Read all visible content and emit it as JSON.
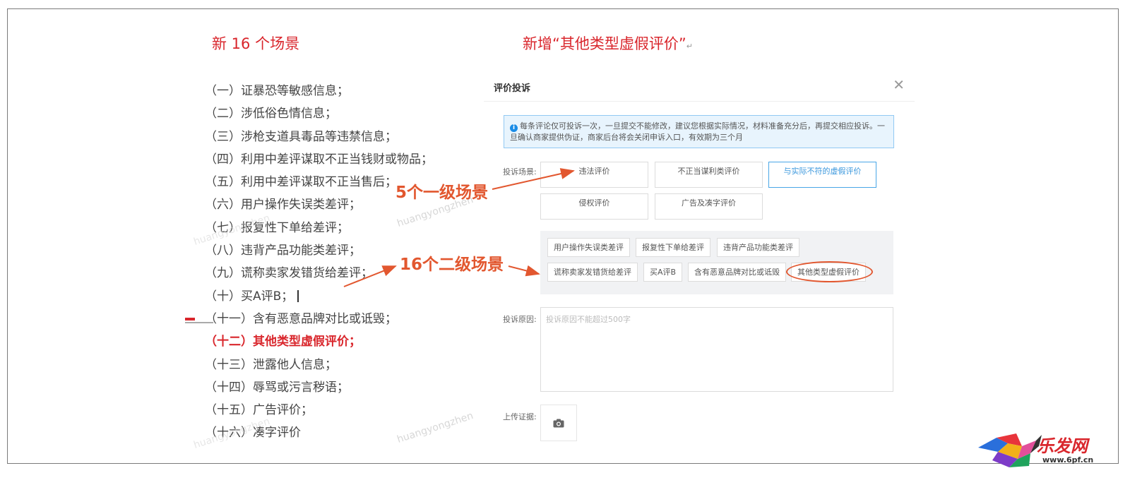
{
  "slide": {
    "left_title": "新 16 个场景",
    "right_title": "新增“其他类型虚假评价”",
    "right_title_mark": "↵",
    "scenes": [
      "（一）证暴恐等敏感信息；",
      "（二）涉低俗色情信息；",
      "（三）涉枪支道具毒品等违禁信息；",
      "（四）利用中差评谋取不正当钱财或物品；",
      "（五）利用中差评谋取不正当售后；",
      "（六）用户操作失误类差评；",
      "（七）报复性下单给差评；",
      "（八）违背产品功能类差评；",
      "（九）谎称卖家发错货给差评；",
      "（十）买A评B；",
      "（十一）含有恶意品牌对比或诋毁；",
      "（十二）其他类型虚假评价；",
      "（十三）泄露他人信息；",
      "（十四）辱骂或污言秽语；",
      "（十五）广告评价；",
      "（十六）凑字评价"
    ],
    "watermarks": [
      "huangyongzhen",
      "huangyongzhen",
      "huangyongzhen",
      "huangyongzhen"
    ]
  },
  "dialog": {
    "title": "评价投诉",
    "close_icon": "close-icon",
    "notice": "每条评论仅可投诉一次，一旦提交不能修改，建议您根据实际情况，材料准备充分后，再提交相应投诉。一旦确认商家提供伪证，商家后台将会关闭申诉入口，有效期为三个月",
    "scene_label": "投诉场景:",
    "level1": [
      "违法评价",
      "不正当谋利类评价",
      "与实际不符的虚假评价",
      "侵权评价",
      "广告及凑字评价"
    ],
    "level2_row1": [
      "用户操作失误类差评",
      "报复性下单给差评",
      "违背产品功能类差评"
    ],
    "level2_row2": [
      "谎称卖家发错货给差评",
      "买A评B",
      "含有恶意品牌对比或诋毁",
      "其他类型虚假评价"
    ],
    "reason_label": "投诉原因:",
    "reason_placeholder": "投诉原因不能超过500字",
    "upload_label": "上传证据:",
    "upload_icon": "camera-icon"
  },
  "annotations": {
    "level1_note": "5个一级场景",
    "level2_note": "16个二级场景"
  },
  "logo": {
    "text": "乐发网",
    "url": "www.6pf.cn"
  },
  "colors": {
    "accent_red": "#d9262c",
    "annotation_orange": "#e2572f",
    "selected_blue": "#3a97dd"
  }
}
